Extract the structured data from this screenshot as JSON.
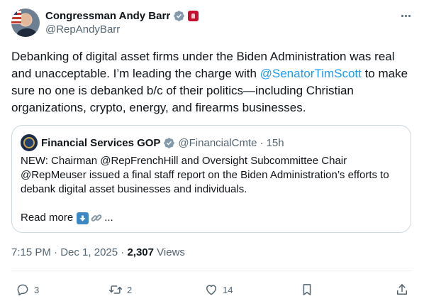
{
  "author": {
    "name": "Congressman Andy Barr",
    "handle": "@RepAndyBarr"
  },
  "tweet": {
    "text_before": "Debanking of digital asset firms under the Biden Administration was real and unacceptable. I’m leading the charge with ",
    "mention": "@SenatorTimScott",
    "text_after": " to make sure no one is debanked b/c of their politics—including Christian organizations, crypto, energy, and firearms businesses."
  },
  "quote": {
    "name": "Financial Services GOP",
    "handle": "@FinancialCmte",
    "separator": "·",
    "time": "15h",
    "text": "NEW: Chairman @RepFrenchHill and Oversight Subcommittee Chair @RepMeuser issued a final staff report on the Biden Administration’s efforts to debank digital asset businesses and individuals.",
    "read_more": "Read more",
    "ellipsis": "..."
  },
  "meta": {
    "time": "7:15 PM",
    "dot": "·",
    "date": "Dec 1, 2025",
    "views_count": "2,307",
    "views_label": "Views"
  },
  "actions": {
    "replies": "3",
    "reposts": "2",
    "likes": "14"
  },
  "icons": {
    "verified": "verified-badge-icon",
    "government": "government-affiliation-icon",
    "more": "more-options-icon",
    "reply": "reply-icon",
    "repost": "repost-icon",
    "like": "like-icon",
    "bookmark": "bookmark-icon",
    "share": "share-icon"
  },
  "colors": {
    "accent": "#1d9bf0",
    "secondary_text": "#536471",
    "gov_badge": "#c8102e"
  }
}
